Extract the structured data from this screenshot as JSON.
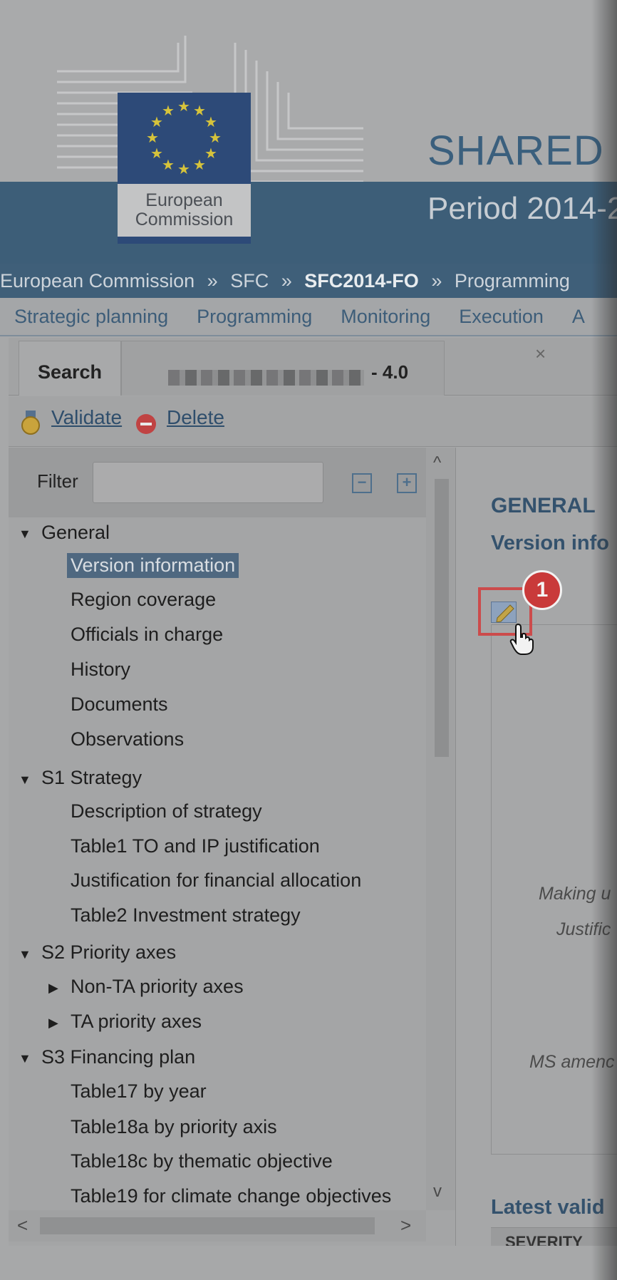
{
  "header": {
    "logo_text": "European\nCommission",
    "app_title": "SHARED",
    "app_subtitle": "Period 2014-2"
  },
  "breadcrumb": {
    "items": [
      "European Commission",
      "SFC",
      "SFC2014-FO",
      "Programming"
    ],
    "separator": "»"
  },
  "menu": {
    "items": [
      "Strategic planning",
      "Programming",
      "Monitoring",
      "Execution",
      "A"
    ]
  },
  "tabs": {
    "search_label": "Search",
    "doc_version": "- 4.0",
    "close_glyph": "×"
  },
  "toolbar": {
    "validate_label": "Validate",
    "delete_label": "Delete"
  },
  "filter": {
    "label": "Filter",
    "value": "",
    "collapse_glyph": "−",
    "expand_glyph": "+"
  },
  "tree": {
    "general": {
      "label": "General",
      "items": [
        "Version information",
        "Region coverage",
        "Officials in charge",
        "History",
        "Documents",
        "Observations"
      ]
    },
    "s1": {
      "label": "S1 Strategy",
      "items": [
        "Description of strategy",
        "Table1 TO and IP justification",
        "Justification for financial allocation",
        "Table2 Investment strategy"
      ]
    },
    "s2": {
      "label": "S2 Priority axes",
      "items": [
        "Non-TA priority axes",
        "TA priority axes"
      ]
    },
    "s3": {
      "label": "S3 Financing plan",
      "items": [
        "Table17 by year",
        "Table18a by priority axis",
        "Table18c by thematic objective",
        "Table19 for climate change objectives"
      ]
    },
    "selected": "Version information"
  },
  "scroll": {
    "up": "^",
    "down": "v",
    "left": "<",
    "right": ">"
  },
  "main": {
    "section_title": "GENERAL",
    "subsection_title": "Version info",
    "badge": "1",
    "labels": [
      "Making u",
      "Justific",
      "MS amenc"
    ],
    "latest_title": "Latest valid",
    "severity_header": "SEVERITY"
  },
  "colors": {
    "accent": "#3d5e78",
    "link": "#2f4e6c",
    "highlight_border": "#cc4b4b",
    "selected_bg": "#4f6880"
  }
}
